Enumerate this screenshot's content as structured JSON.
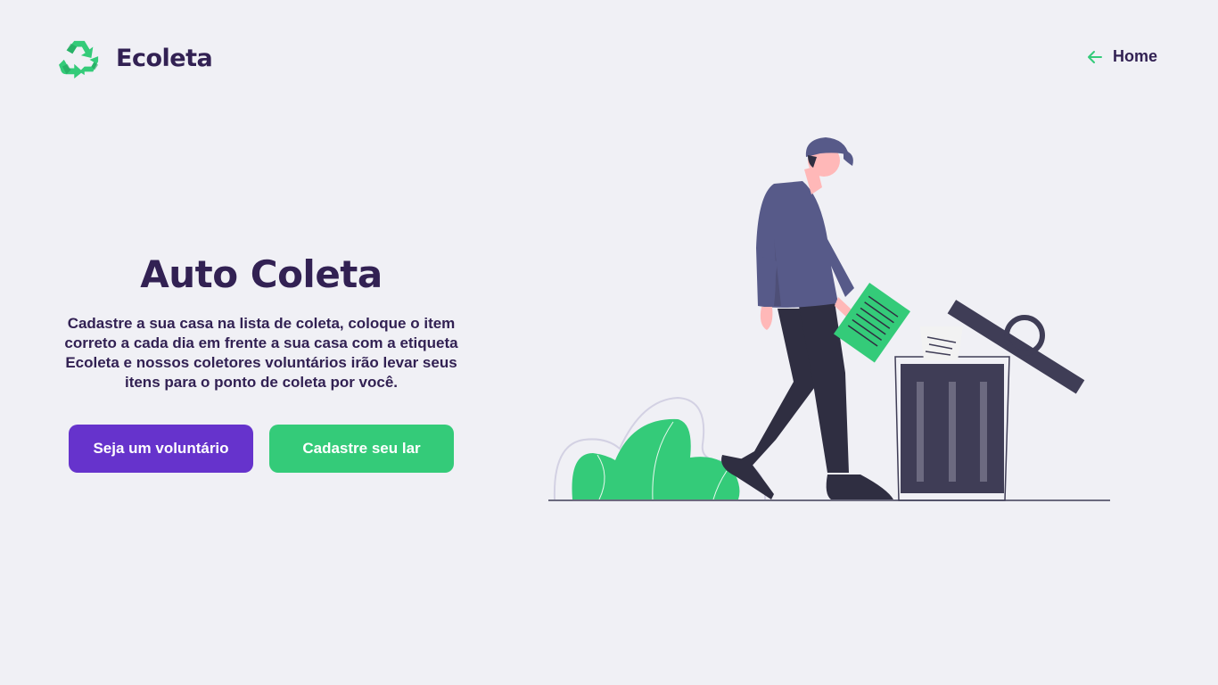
{
  "header": {
    "logo_icon": "recycle-icon",
    "logo_text": "Ecoleta",
    "home_icon": "arrow-left-icon",
    "home_label": "Home"
  },
  "hero": {
    "title": "Auto Coleta",
    "description": "Cadastre a sua casa na lista de coleta, coloque o item correto a cada dia em frente a sua casa com a etiqueta Ecoleta e nossos coletores voluntários irão levar seus itens para o ponto de coleta por você."
  },
  "actions": {
    "volunteer_label": "Seja um voluntário",
    "register_label": "Cadastre seu lar"
  },
  "illustration": {
    "subject": "person-throwing-paper-in-trash-illustration"
  },
  "colors": {
    "background": "#f0f0f5",
    "title": "#322153",
    "primary_green": "#34cb79",
    "purple": "#6633cc",
    "figure_shirt": "#575a89",
    "figure_pants": "#2f2e41",
    "skin": "#ffb8b8"
  }
}
